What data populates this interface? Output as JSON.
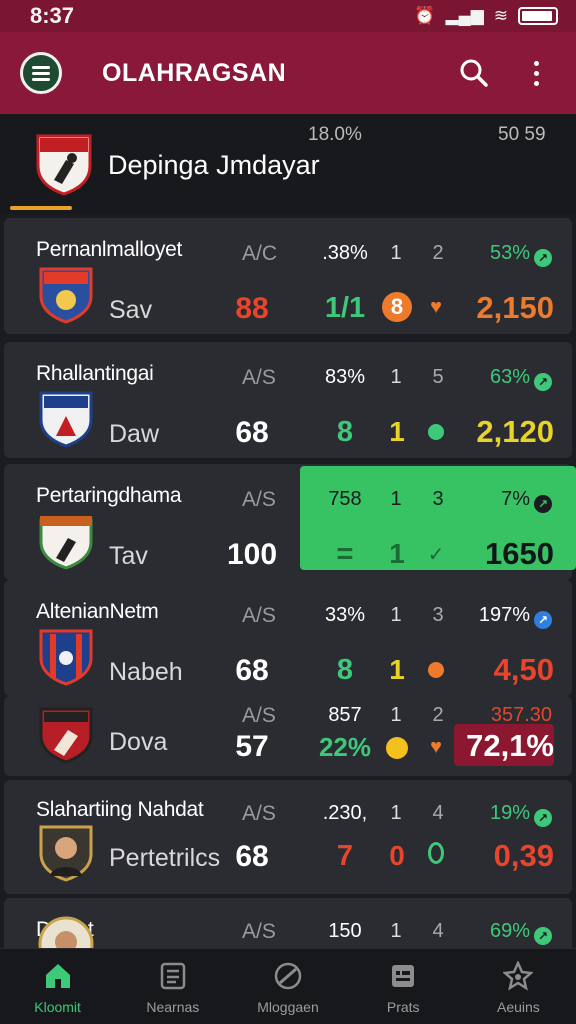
{
  "status": {
    "time": "8:37"
  },
  "appbar": {
    "title": "OLAHRAGSAN"
  },
  "league": {
    "name": "Depinga Jmdayar",
    "stat_a": "18.0%",
    "stat_b": "50 59"
  },
  "rows": [
    {
      "team": "Pernanlmalloyet",
      "abbr": "Sav",
      "type": "A/C",
      "score": "88",
      "pct": ".38%",
      "val": "1/1",
      "c1": "1",
      "c2": "2",
      "m1": "8",
      "rp": "53%",
      "rv": "2,150"
    },
    {
      "team": "Rhallantingai",
      "abbr": "Daw",
      "type": "A/S",
      "score": "68",
      "pct": "83%",
      "val": "8",
      "c1": "1",
      "c2": "5",
      "m1": "1",
      "rp": "63%",
      "rv": "2,120"
    },
    {
      "team": "Pertaringdhama",
      "abbr": "Tav",
      "type": "A/S",
      "score": "100",
      "pct": "758",
      "val": "=",
      "c1": "1",
      "c2": "3",
      "m1": "1",
      "rp": "7%",
      "rv": "1650"
    },
    {
      "team": "AltenianNetm",
      "abbr": "Nabeh",
      "type": "A/S",
      "score": "68",
      "pct": "33%",
      "val": "8",
      "c1": "1",
      "c2": "3",
      "m1": "1",
      "rp": "197%",
      "rv": "4,50"
    },
    {
      "team": "",
      "abbr": "Dova",
      "type": "A/S",
      "score": "57",
      "pct": "857",
      "val": "22%",
      "c1": "1",
      "c2": "2",
      "m1": "",
      "rp": "357.30",
      "rv": "72,1%"
    },
    {
      "team": "Slahartiing Nahdat",
      "abbr": "Pertetrilcs",
      "type": "A/S",
      "score": "68",
      "pct": ".230,",
      "val": "7",
      "c1": "1",
      "c2": "4",
      "m1": "0",
      "rp": "19%",
      "rv": "0,39"
    },
    {
      "team": "Dotliet",
      "abbr": "",
      "type": "A/S",
      "score": "",
      "pct": "150",
      "val": "",
      "c1": "1",
      "c2": "4",
      "m1": "",
      "rp": "69%",
      "rv": ""
    }
  ],
  "tabs": [
    {
      "label": "Kloomit",
      "icon": "home-icon"
    },
    {
      "label": "Nearnas",
      "icon": "news-icon"
    },
    {
      "label": "Mloggaen",
      "icon": "ball-icon"
    },
    {
      "label": "Prats",
      "icon": "stats-icon"
    },
    {
      "label": "Aeuins",
      "icon": "star-icon"
    }
  ],
  "colors": {
    "appbar": "#8a1838",
    "statusbar": "#7a1532",
    "green": "#3ec87a",
    "red": "#e8452c",
    "orange": "#ee7a2c",
    "yellow": "#e8d32a"
  }
}
